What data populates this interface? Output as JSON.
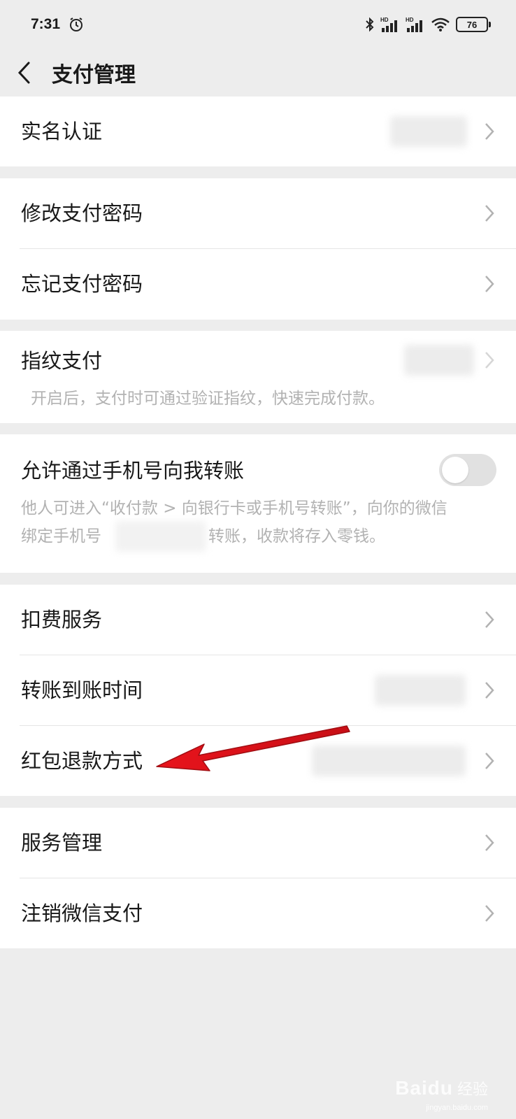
{
  "status_bar": {
    "time": "7:31",
    "battery": "76",
    "icons": [
      "alarm-icon",
      "bluetooth-icon",
      "hd-signal-icon",
      "hd-signal-icon",
      "wifi-icon",
      "battery-icon"
    ]
  },
  "nav": {
    "title": "支付管理",
    "back_icon": "chevron-left-icon"
  },
  "sections": {
    "real_name": {
      "label": "实名认证"
    },
    "change_password": {
      "label": "修改支付密码"
    },
    "forgot_password": {
      "label": "忘记支付密码"
    },
    "fingerprint": {
      "label": "指纹支付",
      "description": "开启后，支付时可通过验证指纹，快速完成付款。"
    },
    "phone_transfer": {
      "label": "允许通过手机号向我转账",
      "description_line1": "他人可进入“收付款 > 向银行卡或手机号转账”，向你的微信",
      "description_line2_prefix": "绑定手机号",
      "description_line2_suffix": "转账，收款将存入零钱。",
      "toggle_on": false
    },
    "deduction_service": {
      "label": "扣费服务"
    },
    "transfer_time": {
      "label": "转账到账时间"
    },
    "red_packet_refund": {
      "label": "红包退款方式"
    },
    "service_management": {
      "label": "服务管理"
    },
    "cancel_wechat_pay": {
      "label": "注销微信支付"
    }
  },
  "watermark": {
    "brand": "Baidu",
    "cn": "经验",
    "sub": "jingyan.baidu.com"
  },
  "colors": {
    "background": "#ededed",
    "card": "#ffffff",
    "text": "#191919",
    "secondary_text": "#b2b2b2",
    "annotation_arrow": "#e8141c"
  }
}
